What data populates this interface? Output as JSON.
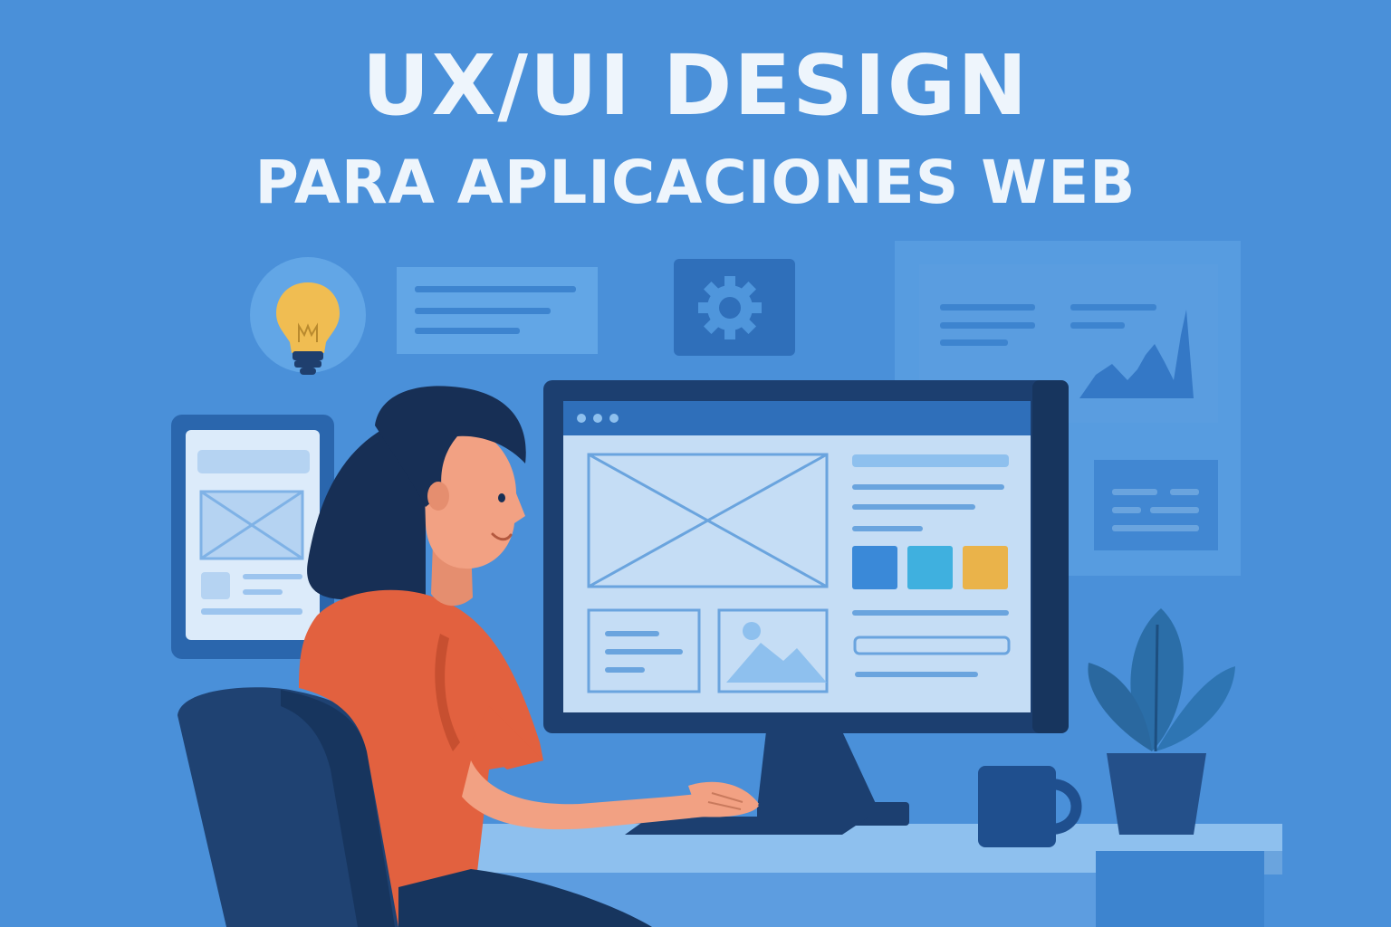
{
  "header": {
    "title": "UX/UI DESIGN",
    "subtitle": "PARA APLICACIONES WEB"
  },
  "palette": {
    "background": "#4a90d9",
    "title_text": "#eef5fc",
    "panel": "#62a6e6",
    "panel_dark": "#3478c6",
    "monitor_frame": "#1c3f70",
    "screen": "#c5ddf5",
    "wire_stroke": "#6aa4de",
    "shirt": "#e2613f",
    "skin": "#f2a183",
    "hair": "#172f55",
    "chair": "#1f4272",
    "swatch_blue": "#3a89d8",
    "swatch_cyan": "#3fb0df",
    "swatch_yellow": "#eab34a",
    "lightbulb": "#f0bd52",
    "plant": "#2b6ea8"
  },
  "icons": [
    "lightbulb-icon",
    "gear-icon",
    "image-placeholder-icon",
    "browser-dots-icon"
  ]
}
